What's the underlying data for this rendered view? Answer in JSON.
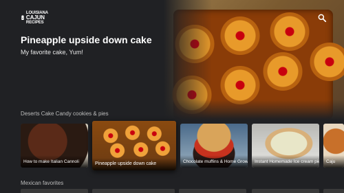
{
  "logo": {
    "line1": "LOUISIANA",
    "line2": "CAJUN",
    "line3": "RECIPES"
  },
  "header": {
    "title": "Pineapple upside down cake",
    "subtitle": "My favorite cake, Yum!"
  },
  "search": {
    "icon": "search-icon"
  },
  "rows": [
    {
      "title": "Deserts Cake Candy cookies & pies",
      "cards": [
        {
          "label": "How to make Italian Cannoli",
          "focused": false
        },
        {
          "label": "Pineapple upside down cake",
          "focused": true
        },
        {
          "label": "Chocolate muffins & Home Grow...",
          "focused": false
        },
        {
          "label": "Instant Homemade Ice cream pie",
          "focused": false
        },
        {
          "label": "Caju",
          "focused": false
        }
      ]
    },
    {
      "title": "Mexican favorites"
    }
  ],
  "colors": {
    "background": "#202124",
    "row_title": "#bdbdbd"
  }
}
